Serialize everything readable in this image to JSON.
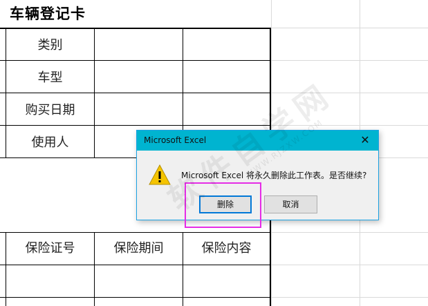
{
  "sheet": {
    "title": "车辆登记卡",
    "rows_top": [
      "类别",
      "车型",
      "购买日期",
      "使用人"
    ],
    "headers_bottom": [
      "保险证号",
      "保险期间",
      "保险内容"
    ]
  },
  "dialog": {
    "title": "Microsoft Excel",
    "message": "Microsoft Excel 将永久删除此工作表。是否继续?",
    "delete_label": "删除",
    "cancel_label": "取消",
    "close_glyph": "✕"
  },
  "watermark": {
    "text": "软件自学网",
    "sub": "WWW.RJZXW.COM"
  },
  "colors": {
    "titlebar": "#00b4d0",
    "highlight": "#e52ce6",
    "primary_border": "#0078d7"
  }
}
